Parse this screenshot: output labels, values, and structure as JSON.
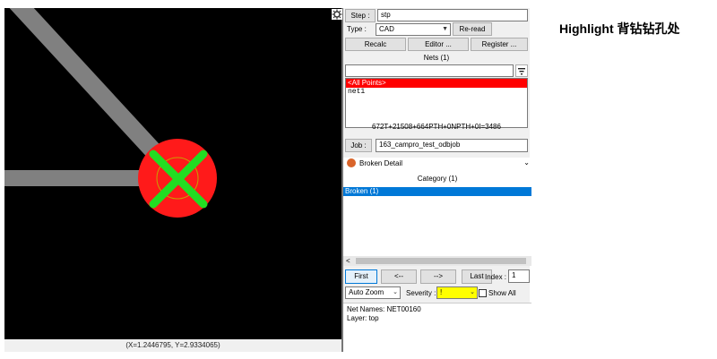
{
  "title": "Highlight 背钻钻孔处",
  "canvas": {
    "coords": "(X=1.2446795, Y=2.9334065)"
  },
  "panel": {
    "step_label": "Step :",
    "step_value": "stp",
    "type_label": "Type :",
    "type_value": "CAD",
    "reread_label": "Re-read",
    "recalc_label": "Recalc",
    "editor_label": "Editor ...",
    "register_label": "Register ...",
    "nets_header": "Nets (1)",
    "net_items": [
      "<All Points>",
      "net1"
    ],
    "summary": "672T+21508+664PTH+0NPTH+0I=3486",
    "job_label": "Job :",
    "job_value": "163_campro_test_odbjob",
    "broken_detail_title": "Broken Detail",
    "category_header": "Category (1)",
    "category_item": "Broken (1)",
    "scroll_left": "<",
    "nav_first": "First",
    "nav_prev": "<--",
    "nav_next": "-->",
    "nav_last": "Last",
    "index_label": "Index :",
    "index_value": "1",
    "autozoom_value": "Auto Zoom",
    "severity_label": "Severity :",
    "severity_value": "!",
    "show_all_label": "Show All",
    "detail_line1": "Net Names: NET00160",
    "detail_line2": "Layer: top"
  },
  "colors": {
    "canvas_bg": "#000000",
    "trace": "#808080",
    "pad": "#ff1a1a",
    "cross": "#22dd22",
    "selected_row": "#ff0000",
    "category_selected": "#0078d7",
    "severity_bg": "#ffff00"
  },
  "icons": {
    "gear": "gear-icon",
    "filter": "filter-icon",
    "broken_detail": "broken-detail-icon"
  }
}
